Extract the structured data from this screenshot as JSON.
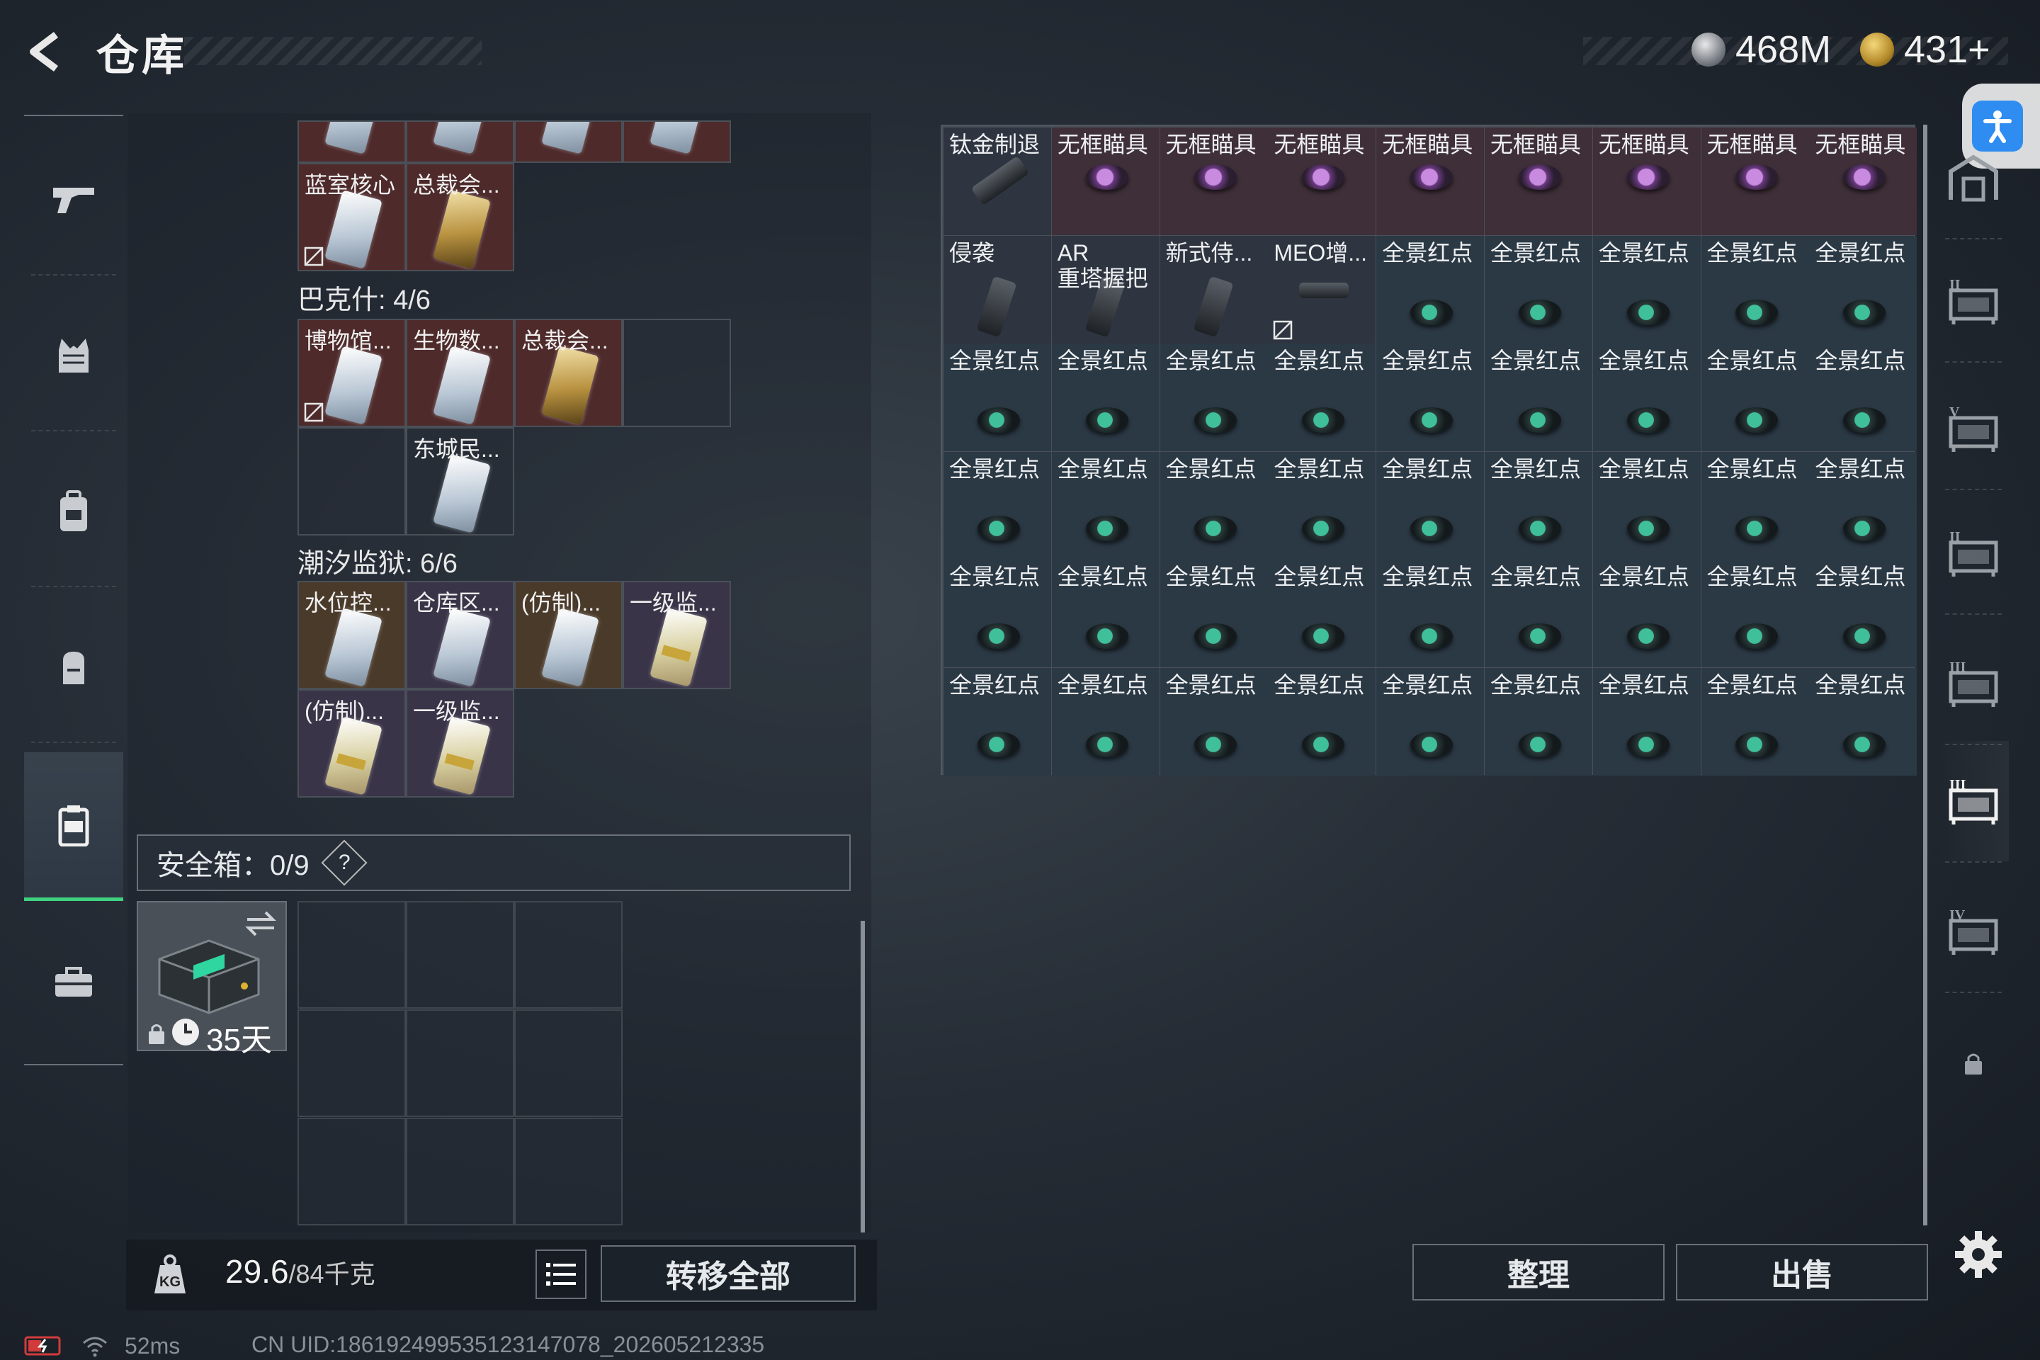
{
  "header": {
    "title": "仓库",
    "currency": [
      {
        "value": "468M"
      },
      {
        "value": "431+"
      }
    ]
  },
  "left_nav": [
    "weapon",
    "armor",
    "chest-rig",
    "backpack",
    "container",
    "case"
  ],
  "stash": {
    "groups": [
      {
        "title": "巴克什: 4/6"
      },
      {
        "title": "潮汐监狱: 6/6"
      }
    ],
    "top_cells": [
      {
        "name": "蓝室核心",
        "type": "red",
        "card": "w",
        "locked": true
      },
      {
        "name": "总裁会...",
        "type": "red",
        "card": "g",
        "locked": false
      }
    ],
    "bakesh_cells": [
      {
        "name": "博物馆...",
        "type": "red",
        "card": "w",
        "locked": true
      },
      {
        "name": "生物数...",
        "type": "red",
        "card": "w",
        "locked": false
      },
      {
        "name": "总裁会...",
        "type": "red",
        "card": "g",
        "locked": false
      },
      {
        "name": "东城民...",
        "type": "empty-card",
        "card": "w",
        "locked": false
      }
    ],
    "tide_cells": [
      {
        "name": "水位控...",
        "type": "gold",
        "card": "w"
      },
      {
        "name": "仓库区...",
        "type": "purple",
        "card": "w"
      },
      {
        "name": "(仿制)...",
        "type": "gold",
        "card": "w"
      },
      {
        "name": "一级监...",
        "type": "purple",
        "card": "y"
      },
      {
        "name": "(仿制)...",
        "type": "purple",
        "card": "y"
      },
      {
        "name": "一级监...",
        "type": "purple",
        "card": "y"
      }
    ],
    "safe": {
      "label": "安全箱：0/9",
      "help": "?",
      "timer": "35天"
    },
    "weight": {
      "current": "29.6",
      "max": "/84千克"
    },
    "transfer_label": "转移全部"
  },
  "warehouse": {
    "rows": [
      [
        {
          "n": "钛金制退",
          "c": "dark",
          "i": "barrel"
        },
        {
          "n": "无框瞄具",
          "c": "red",
          "i": "pscope"
        },
        {
          "n": "无框瞄具",
          "c": "red",
          "i": "pscope"
        },
        {
          "n": "无框瞄具",
          "c": "red",
          "i": "pscope"
        },
        {
          "n": "无框瞄具",
          "c": "red",
          "i": "pscope"
        },
        {
          "n": "无框瞄具",
          "c": "red",
          "i": "pscope"
        },
        {
          "n": "无框瞄具",
          "c": "red",
          "i": "pscope"
        },
        {
          "n": "无框瞄具",
          "c": "red",
          "i": "pscope"
        },
        {
          "n": "无框瞄具",
          "c": "red",
          "i": "pscope"
        }
      ],
      [
        {
          "n": "侵袭",
          "c": "dark",
          "i": "grip"
        },
        {
          "n": "AR\n重塔握把",
          "c": "dark",
          "i": "grip"
        },
        {
          "n": "新式侍...",
          "c": "dark",
          "i": "grip"
        },
        {
          "n": "MEO增...",
          "c": "dark",
          "i": "rail"
        },
        {
          "n": "全景红点",
          "c": "green",
          "i": "scope"
        },
        {
          "n": "全景红点",
          "c": "green",
          "i": "scope"
        },
        {
          "n": "全景红点",
          "c": "green",
          "i": "scope"
        },
        {
          "n": "全景红点",
          "c": "green",
          "i": "scope"
        },
        {
          "n": "全景红点",
          "c": "green",
          "i": "scope"
        }
      ],
      [
        {
          "n": "全景红点",
          "c": "green",
          "i": "scope"
        },
        {
          "n": "全景红点",
          "c": "green",
          "i": "scope"
        },
        {
          "n": "全景红点",
          "c": "green",
          "i": "scope"
        },
        {
          "n": "全景红点",
          "c": "green",
          "i": "scope"
        },
        {
          "n": "全景红点",
          "c": "green",
          "i": "scope"
        },
        {
          "n": "全景红点",
          "c": "green",
          "i": "scope"
        },
        {
          "n": "全景红点",
          "c": "green",
          "i": "scope"
        },
        {
          "n": "全景红点",
          "c": "green",
          "i": "scope"
        },
        {
          "n": "全景红点",
          "c": "green",
          "i": "scope"
        }
      ],
      [
        {
          "n": "全景红点",
          "c": "green",
          "i": "scope"
        },
        {
          "n": "全景红点",
          "c": "green",
          "i": "scope"
        },
        {
          "n": "全景红点",
          "c": "green",
          "i": "scope"
        },
        {
          "n": "全景红点",
          "c": "green",
          "i": "scope"
        },
        {
          "n": "全景红点",
          "c": "green",
          "i": "scope"
        },
        {
          "n": "全景红点",
          "c": "green",
          "i": "scope"
        },
        {
          "n": "全景红点",
          "c": "green",
          "i": "scope"
        },
        {
          "n": "全景红点",
          "c": "green",
          "i": "scope"
        },
        {
          "n": "全景红点",
          "c": "green",
          "i": "scope"
        }
      ],
      [
        {
          "n": "全景红点",
          "c": "green",
          "i": "scope"
        },
        {
          "n": "全景红点",
          "c": "green",
          "i": "scope"
        },
        {
          "n": "全景红点",
          "c": "green",
          "i": "scope"
        },
        {
          "n": "全景红点",
          "c": "green",
          "i": "scope"
        },
        {
          "n": "全景红点",
          "c": "green",
          "i": "scope"
        },
        {
          "n": "全景红点",
          "c": "green",
          "i": "scope"
        },
        {
          "n": "全景红点",
          "c": "green",
          "i": "scope"
        },
        {
          "n": "全景红点",
          "c": "green",
          "i": "scope"
        },
        {
          "n": "全景红点",
          "c": "green",
          "i": "scope"
        }
      ],
      [
        {
          "n": "全景红点",
          "c": "green",
          "i": "scope"
        },
        {
          "n": "全景红点",
          "c": "green",
          "i": "scope"
        },
        {
          "n": "全景红点",
          "c": "green",
          "i": "scope"
        },
        {
          "n": "全景红点",
          "c": "green",
          "i": "scope"
        },
        {
          "n": "全景红点",
          "c": "green",
          "i": "scope"
        },
        {
          "n": "全景红点",
          "c": "green",
          "i": "scope"
        },
        {
          "n": "全景红点",
          "c": "green",
          "i": "scope"
        },
        {
          "n": "全景红点",
          "c": "green",
          "i": "scope"
        },
        {
          "n": "全景红点",
          "c": "green",
          "i": "scope"
        }
      ]
    ]
  },
  "right_nav": [
    {
      "label": "",
      "icon": "home-vault-icon"
    },
    {
      "label": "II",
      "icon": "vault-2-icon"
    },
    {
      "label": "V",
      "icon": "vault-5-icon"
    },
    {
      "label": "II",
      "icon": "vault-2b-icon"
    },
    {
      "label": "III",
      "icon": "vault-3-icon"
    },
    {
      "label": "III",
      "icon": "vault-3b-icon"
    },
    {
      "label": "IV",
      "icon": "vault-4-icon"
    },
    {
      "label": "",
      "icon": "lock-icon"
    }
  ],
  "buttons": {
    "sort": "整理",
    "sell": "出售"
  },
  "status": {
    "ping": "52ms",
    "uid": "CN UID:18619249953512314707​8_202605212335"
  }
}
